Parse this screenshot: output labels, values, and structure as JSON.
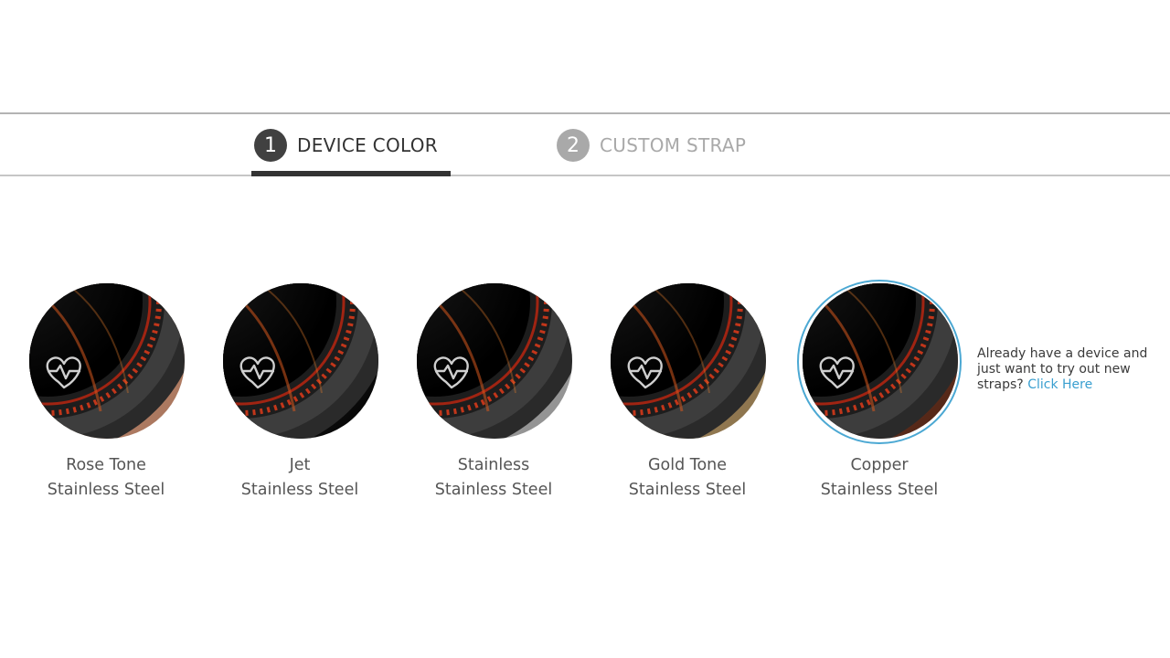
{
  "steps": [
    {
      "number": "1",
      "label": "DEVICE COLOR",
      "active": true
    },
    {
      "number": "2",
      "label": "CUSTOM STRAP",
      "active": false
    }
  ],
  "colors": {
    "active_step": "#414141",
    "inactive_step": "#a9a9a9",
    "selected_ring": "#4ba8d3",
    "link": "#3a9fd0"
  },
  "device_colors": [
    {
      "line1": "Rose Tone",
      "line2": "Stainless Steel",
      "bezel_color": "#c08d74",
      "selected": false
    },
    {
      "line1": "Jet",
      "line2": "Stainless Steel",
      "bezel_color": "#1a1a1a",
      "selected": false
    },
    {
      "line1": "Stainless",
      "line2": "Stainless Steel",
      "bezel_color": "#a8a8a8",
      "selected": false
    },
    {
      "line1": "Gold Tone",
      "line2": "Stainless Steel",
      "bezel_color": "#a38a63",
      "selected": false
    },
    {
      "line1": "Copper",
      "line2": "Stainless Steel",
      "bezel_color": "#6a3c2c",
      "selected": true
    }
  ],
  "device_note": {
    "text": "Already have a device and just want to try out new straps?",
    "link_label": "Click Here"
  }
}
